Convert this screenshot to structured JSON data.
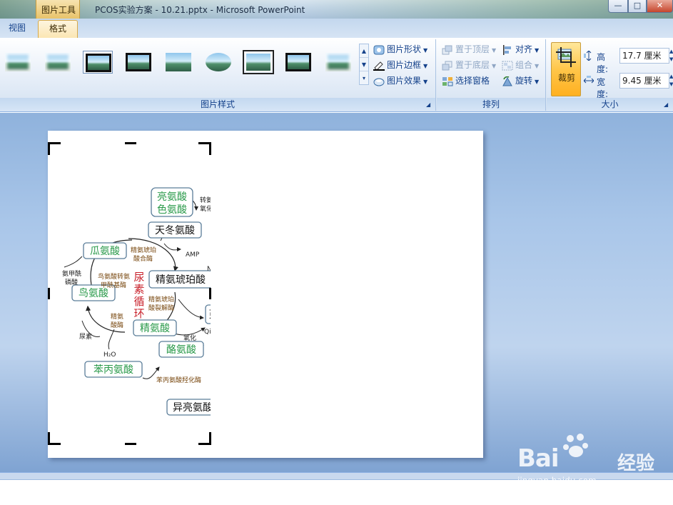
{
  "titlebar": {
    "contextual_tab": "图片工具",
    "title": "PCOS实验方案 - 10.21.pptx - Microsoft PowerPoint",
    "min_glyph": "—",
    "max_glyph": "□",
    "close_glyph": "✕"
  },
  "tabs": {
    "view": "视图",
    "format": "格式"
  },
  "ribbon": {
    "styles": {
      "label": "图片样式",
      "shape": "图片形状",
      "border": "图片边框",
      "effects": "图片效果"
    },
    "arrange": {
      "label": "排列",
      "bring_front": "置于顶层",
      "send_back": "置于底层",
      "selection_pane": "选择窗格",
      "align": "对齐",
      "group": "组合",
      "rotate": "旋转"
    },
    "size": {
      "label": "大小",
      "crop": "裁剪",
      "height_label": "高度:",
      "height_value": "17.7 厘米",
      "width_label": "宽度:",
      "width_value": "9.45 厘米"
    },
    "colors": {
      "accent": "#ffc64a",
      "ribbon_text": "#15428b"
    }
  },
  "diagram": {
    "nodes": {
      "leu_trp": [
        "亮氨酸",
        "色氨酸"
      ],
      "asp": "天冬氨酸",
      "citrulline": "瓜氨酸",
      "argsucc": "精氨琥珀酸",
      "ornithine": "鸟氨酸",
      "arginine": "精氨酸",
      "tyrosine": "酪氨酸",
      "phe": "苯丙氨酸",
      "ile": "异亮氨酸",
      "partial_right": "延"
    },
    "cycle_label": [
      "尿",
      "素",
      "循",
      "环"
    ],
    "annotations": {
      "transam": "转氨",
      "oxid": "氧化酶",
      "amp": "AMP",
      "na": "NA",
      "ass": [
        "精氨琥珀",
        "酸合酶"
      ],
      "carbamoyl": [
        "氨甲酰",
        "磷酸"
      ],
      "otc": [
        "鸟氨酸转氨",
        "甲酰基酶"
      ],
      "asl": [
        "精氨琥珀",
        "酸裂解酶"
      ],
      "arginase": [
        "精氨",
        "酸酶"
      ],
      "urea": "尿素",
      "h2o": "H₂O",
      "oxid2": "氧化",
      "qi": "Qi",
      "pah": "苯丙氨酸羟化酶"
    }
  },
  "watermark": {
    "brand": "Bai",
    "cn": "经验",
    "url": "jingyan.baidu.com"
  }
}
